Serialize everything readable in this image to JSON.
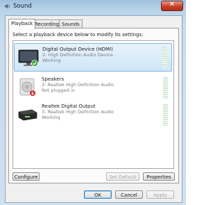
{
  "window": {
    "title": "Sound",
    "close_glyph": "✕"
  },
  "tabs": [
    {
      "label": "Playback",
      "active": true
    },
    {
      "label": "Recording",
      "active": false
    },
    {
      "label": "Sounds",
      "active": false
    }
  ],
  "instruction": "Select a playback device below to modify its settings:",
  "devices": [
    {
      "name": "Digital Output Device (HDMI)",
      "line1": "2- High Definition Audio Device",
      "line2": "Working",
      "icon": "hdmi-monitor-icon",
      "status_icon": "default-check-icon",
      "selected": true
    },
    {
      "name": "Speakers",
      "line1": "3- Realtek High Definition Audio",
      "line2": "Not plugged in",
      "icon": "speaker-icon",
      "status_icon": "unplugged-icon",
      "selected": false
    },
    {
      "name": "Realtek Digital Output",
      "line1": "3- Realtek High Definition Audio",
      "line2": "Working",
      "icon": "digital-output-icon",
      "status_icon": "",
      "selected": false
    }
  ],
  "buttons": {
    "configure": "Configure",
    "set_default": "Set Default",
    "properties": "Properties",
    "ok": "OK",
    "cancel": "Cancel",
    "apply": "Apply"
  },
  "colors": {
    "selection": "#cfe6f8",
    "close": "#c7412b",
    "meter": "#cfe9cf"
  }
}
